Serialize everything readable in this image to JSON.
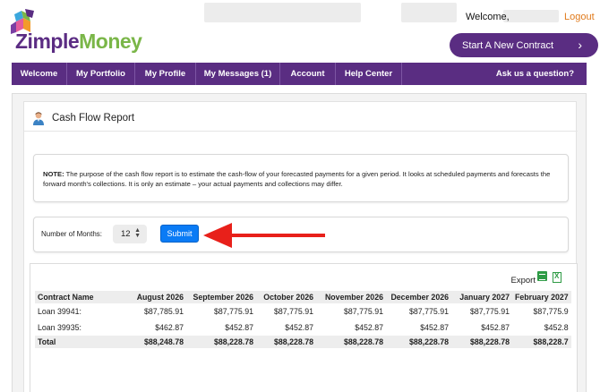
{
  "header": {
    "brand_first": "Zimple",
    "brand_second": "Money",
    "welcome": "Welcome,",
    "logout": "Logout",
    "start_contract": "Start A New Contract",
    "colors": {
      "brand_purple": "#5a2d82",
      "brand_green": "#7ab648",
      "logout_orange": "#e07a1b"
    }
  },
  "nav": {
    "welcome": "Welcome",
    "portfolio": "My Portfolio",
    "profile": "My Profile",
    "messages": "My Messages (1)",
    "account": "Account",
    "help": "Help Center",
    "ask": "Ask us a question?"
  },
  "report": {
    "title": "Cash Flow Report",
    "note_label": "NOTE:",
    "note_text": " The purpose of the cash flow report is to estimate the cash-flow of your forecasted payments for a given period. It looks at scheduled payments and forecasts the forward month's collections. It is only an estimate – your actual payments and collections may differ.",
    "months_label": "Number of Months:",
    "months_value": "12",
    "submit": "Submit",
    "export": "Export"
  },
  "table": {
    "headers": [
      "Contract Name",
      "August 2026",
      "September 2026",
      "October 2026",
      "November 2026",
      "December 2026",
      "January 2027",
      "February 2027"
    ],
    "rows": [
      [
        "Loan 39941:",
        "$87,785.91",
        "$87,775.91",
        "$87,775.91",
        "$87,775.91",
        "$87,775.91",
        "$87,775.91",
        "$87,775.9"
      ],
      [
        "Loan 39935:",
        "$462.87",
        "$452.87",
        "$452.87",
        "$452.87",
        "$452.87",
        "$452.87",
        "$452.8"
      ]
    ],
    "total": [
      "Total",
      "$88,248.78",
      "$88,228.78",
      "$88,228.78",
      "$88,228.78",
      "$88,228.78",
      "$88,228.78",
      "$88,228.7"
    ]
  }
}
